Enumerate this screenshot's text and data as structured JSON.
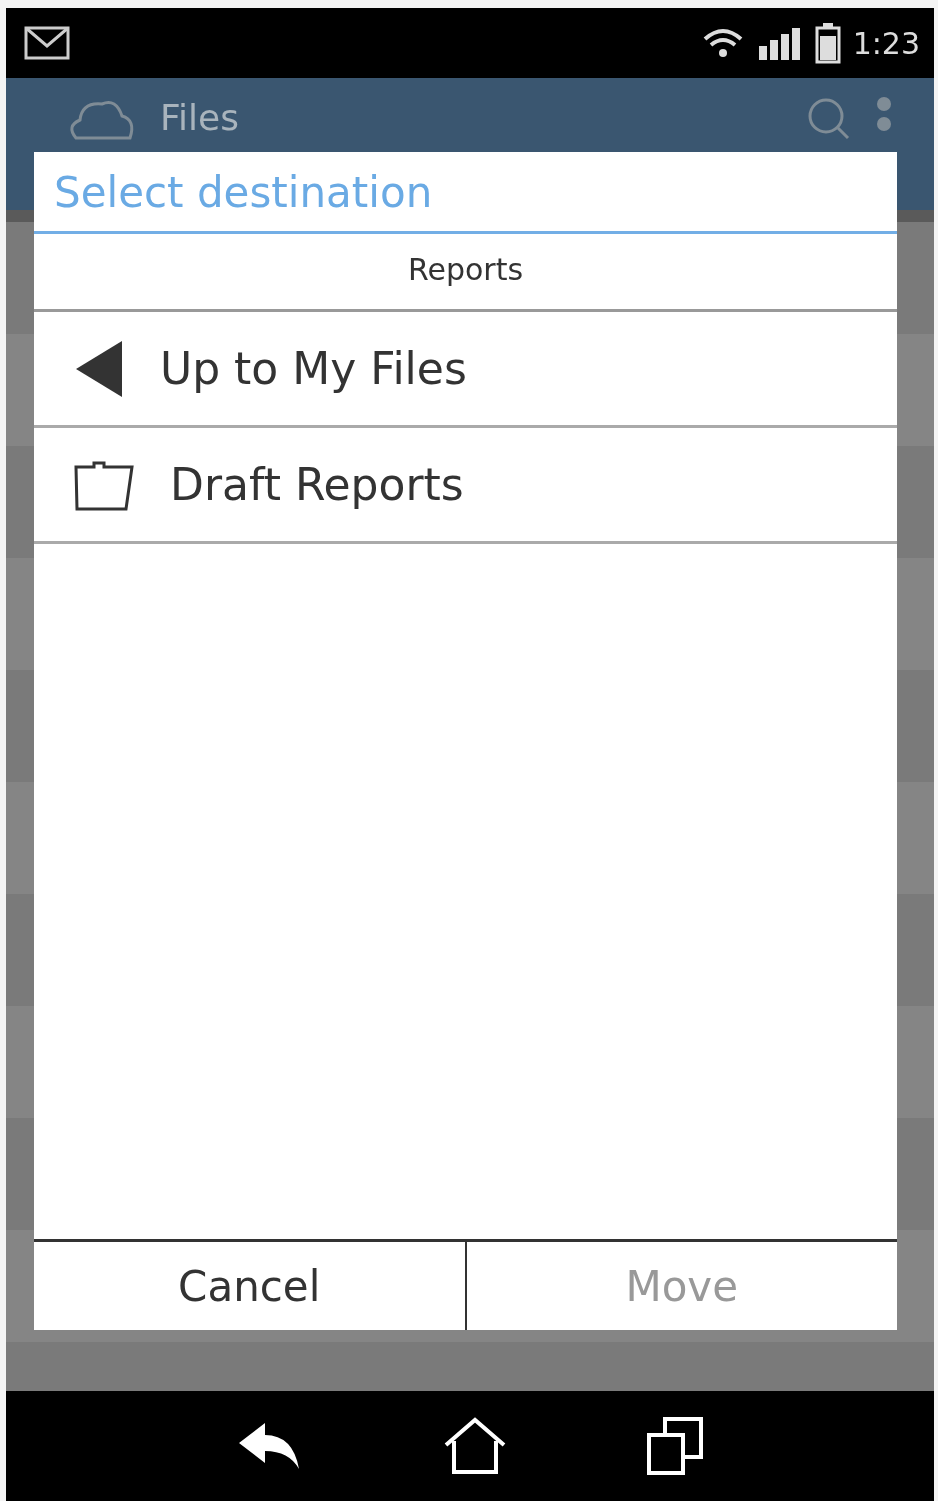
{
  "status_bar": {
    "time": "1:23"
  },
  "app_bar": {
    "title": "Files"
  },
  "dialog": {
    "title": "Select destination",
    "folder": "Reports",
    "items": [
      {
        "kind": "back",
        "label": "Up to My Files"
      },
      {
        "kind": "folder",
        "label": "Draft Reports"
      }
    ],
    "buttons": [
      {
        "label": "Cancel",
        "disabled": false
      },
      {
        "label": "Move",
        "disabled": true
      }
    ]
  }
}
